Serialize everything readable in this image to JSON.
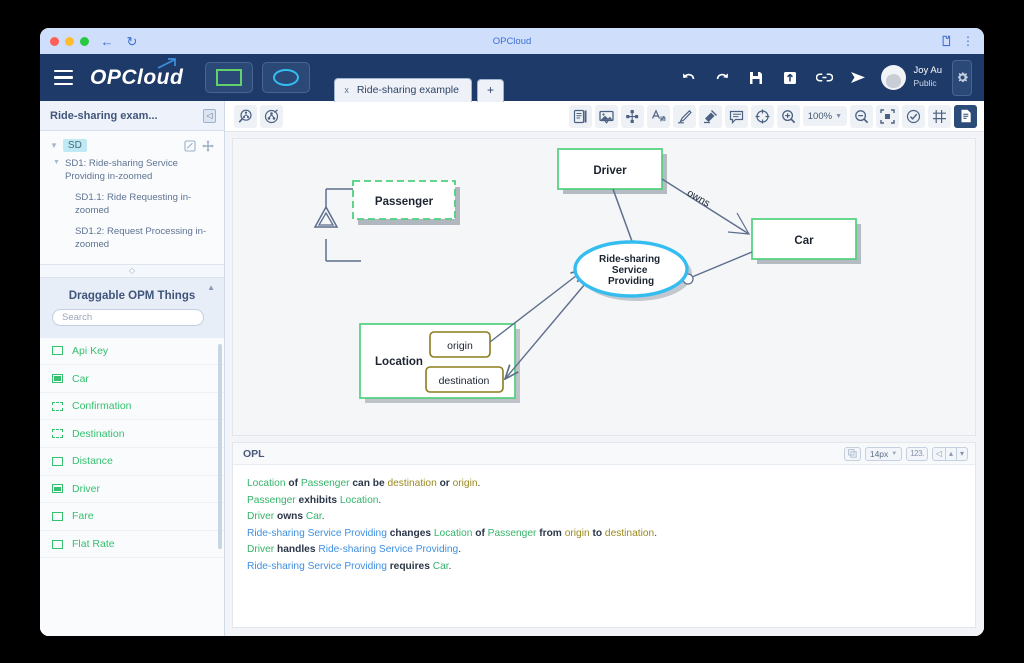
{
  "browser": {
    "title": "OPCloud",
    "back_icon": "back-arrow-icon",
    "reload_icon": "reload-icon",
    "extension_icon": "extension-puzzle-icon",
    "menu_icon": "kebab-menu-icon"
  },
  "navbar": {
    "menu_icon": "hamburger-menu-icon",
    "brand": "OPCloud",
    "view_object_label": "object-view-toggle",
    "view_process_label": "process-view-toggle",
    "tab": {
      "label": "Ride-sharing example",
      "close": "x"
    },
    "add_tab": "+",
    "actions": [
      {
        "name": "undo-button",
        "icon": "undo-icon"
      },
      {
        "name": "redo-button",
        "icon": "redo-icon"
      },
      {
        "name": "save-button",
        "icon": "save-disk-icon"
      },
      {
        "name": "export-button",
        "icon": "export-up-icon"
      },
      {
        "name": "link-button",
        "icon": "link-icon"
      },
      {
        "name": "send-button",
        "icon": "send-paper-plane-icon"
      }
    ],
    "user": {
      "name": "Joy Au",
      "role": "Public"
    },
    "settings_icon": "gear-icon"
  },
  "sidebar": {
    "title": "Ride-sharing exam...",
    "collapse_icon": "collapse-panel-icon",
    "tree": {
      "root_label": "SD",
      "edit_icon": "edit-pencil-icon",
      "move_icon": "move-arrows-icon",
      "items": [
        {
          "label": "SD1: Ride-sharing Service Providing in-zoomed",
          "level": 1,
          "caret": true
        },
        {
          "label": "SD1.1: Ride Requesting in-zoomed",
          "level": 2,
          "caret": false
        },
        {
          "label": "SD1.2: Request Processing in-zoomed",
          "level": 2,
          "caret": false
        }
      ]
    },
    "things": {
      "title": "Draggable OPM Things",
      "collapse_icon": "chevron-up-icon",
      "search_placeholder": "Search",
      "search_value": "",
      "visibility_icon": "eye-icon",
      "items": [
        {
          "label": "Api Key",
          "glyph": "solid"
        },
        {
          "label": "Car",
          "glyph": "filled"
        },
        {
          "label": "Confirmation",
          "glyph": "dashed"
        },
        {
          "label": "Destination",
          "glyph": "dashed"
        },
        {
          "label": "Distance",
          "glyph": "solid"
        },
        {
          "label": "Driver",
          "glyph": "filled"
        },
        {
          "label": "Fare",
          "glyph": "solid"
        },
        {
          "label": "Flat Rate",
          "glyph": "solid"
        }
      ]
    }
  },
  "canvas_toolbar": {
    "left": [
      {
        "name": "zoom-in-diagram-button",
        "icon": "magnifier-tree-icon"
      },
      {
        "name": "unfold-diagram-button",
        "icon": "circled-nodes-icon"
      }
    ],
    "right": [
      {
        "name": "notes-button",
        "icon": "notebook-icon"
      },
      {
        "name": "image-button",
        "icon": "picture-icon"
      },
      {
        "name": "structure-button",
        "icon": "node-tree-icon"
      },
      {
        "name": "text-style-button",
        "icon": "text-style-icon"
      },
      {
        "name": "draw-button",
        "icon": "pen-icon"
      },
      {
        "name": "stamp-button",
        "icon": "stamp-icon"
      },
      {
        "name": "comment-button",
        "icon": "comment-icon"
      },
      {
        "name": "target-button",
        "icon": "crosshair-icon"
      },
      {
        "name": "zoom-in-button",
        "icon": "zoom-in-icon"
      }
    ],
    "zoom_level": "100%",
    "after_zoom": [
      {
        "name": "zoom-out-button",
        "icon": "zoom-out-icon"
      },
      {
        "name": "fit-screen-button",
        "icon": "fit-screen-icon"
      },
      {
        "name": "validate-button",
        "icon": "check-circle-icon"
      },
      {
        "name": "grid-button",
        "icon": "grid-icon"
      },
      {
        "name": "opl-toggle-button",
        "icon": "document-icon"
      }
    ]
  },
  "diagram": {
    "objects": [
      {
        "name": "passenger",
        "label": "Passenger",
        "style": "dashed"
      },
      {
        "name": "location",
        "label": "Location",
        "style": "solid"
      },
      {
        "name": "driver",
        "label": "Driver",
        "style": "solid"
      },
      {
        "name": "car",
        "label": "Car",
        "style": "solid"
      }
    ],
    "states": [
      {
        "name": "origin",
        "label": "origin"
      },
      {
        "name": "destination",
        "label": "destination"
      }
    ],
    "process": {
      "name": "ride-sharing-service-providing",
      "label": "Ride-sharing Service Providing"
    },
    "links": [
      {
        "name": "owns-link",
        "label": "owns"
      }
    ]
  },
  "opl": {
    "title": "OPL",
    "font_size": "14px",
    "copy_icon": "copy-opl-icon",
    "numbering_icon": "numbering-icon",
    "nav_icons": [
      "collapse-left-icon",
      "scroll-up-icon",
      "scroll-down-icon"
    ],
    "lines": [
      [
        {
          "t": "Location",
          "c": "ob"
        },
        {
          "t": " of ",
          "c": "kw"
        },
        {
          "t": "Passenger",
          "c": "ob"
        },
        {
          "t": " can be ",
          "c": "kw"
        },
        {
          "t": "destination",
          "c": "st"
        },
        {
          "t": " or ",
          "c": "kw"
        },
        {
          "t": "origin",
          "c": "st"
        },
        {
          "t": ".",
          "c": "pl"
        }
      ],
      [
        {
          "t": "Passenger",
          "c": "ob"
        },
        {
          "t": " exhibits ",
          "c": "kw"
        },
        {
          "t": "Location",
          "c": "ob"
        },
        {
          "t": ".",
          "c": "pl"
        }
      ],
      [
        {
          "t": "Driver",
          "c": "ob"
        },
        {
          "t": " owns ",
          "c": "kw"
        },
        {
          "t": "Car",
          "c": "ob"
        },
        {
          "t": ".",
          "c": "pl"
        }
      ],
      [
        {
          "t": "Ride-sharing Service Providing",
          "c": "pr"
        },
        {
          "t": " changes ",
          "c": "kw"
        },
        {
          "t": "Location",
          "c": "ob"
        },
        {
          "t": " of ",
          "c": "kw"
        },
        {
          "t": "Passenger",
          "c": "ob"
        },
        {
          "t": " from ",
          "c": "kw"
        },
        {
          "t": "origin",
          "c": "st"
        },
        {
          "t": " to ",
          "c": "kw"
        },
        {
          "t": "destination",
          "c": "st"
        },
        {
          "t": ".",
          "c": "pl"
        }
      ],
      [
        {
          "t": "Driver",
          "c": "ob"
        },
        {
          "t": " handles ",
          "c": "kw"
        },
        {
          "t": "Ride-sharing Service Providing",
          "c": "pr"
        },
        {
          "t": ".",
          "c": "pl"
        }
      ],
      [
        {
          "t": "Ride-sharing Service Providing",
          "c": "pr"
        },
        {
          "t": " requires ",
          "c": "kw"
        },
        {
          "t": "Car",
          "c": "ob"
        },
        {
          "t": ".",
          "c": "pl"
        }
      ]
    ]
  },
  "colors": {
    "navbar": "#1e3a68",
    "object_green": "#35c16f",
    "process_blue": "#35bdf0",
    "state_olive": "#8a7d1c",
    "link_gray": "#5d6e8c"
  }
}
